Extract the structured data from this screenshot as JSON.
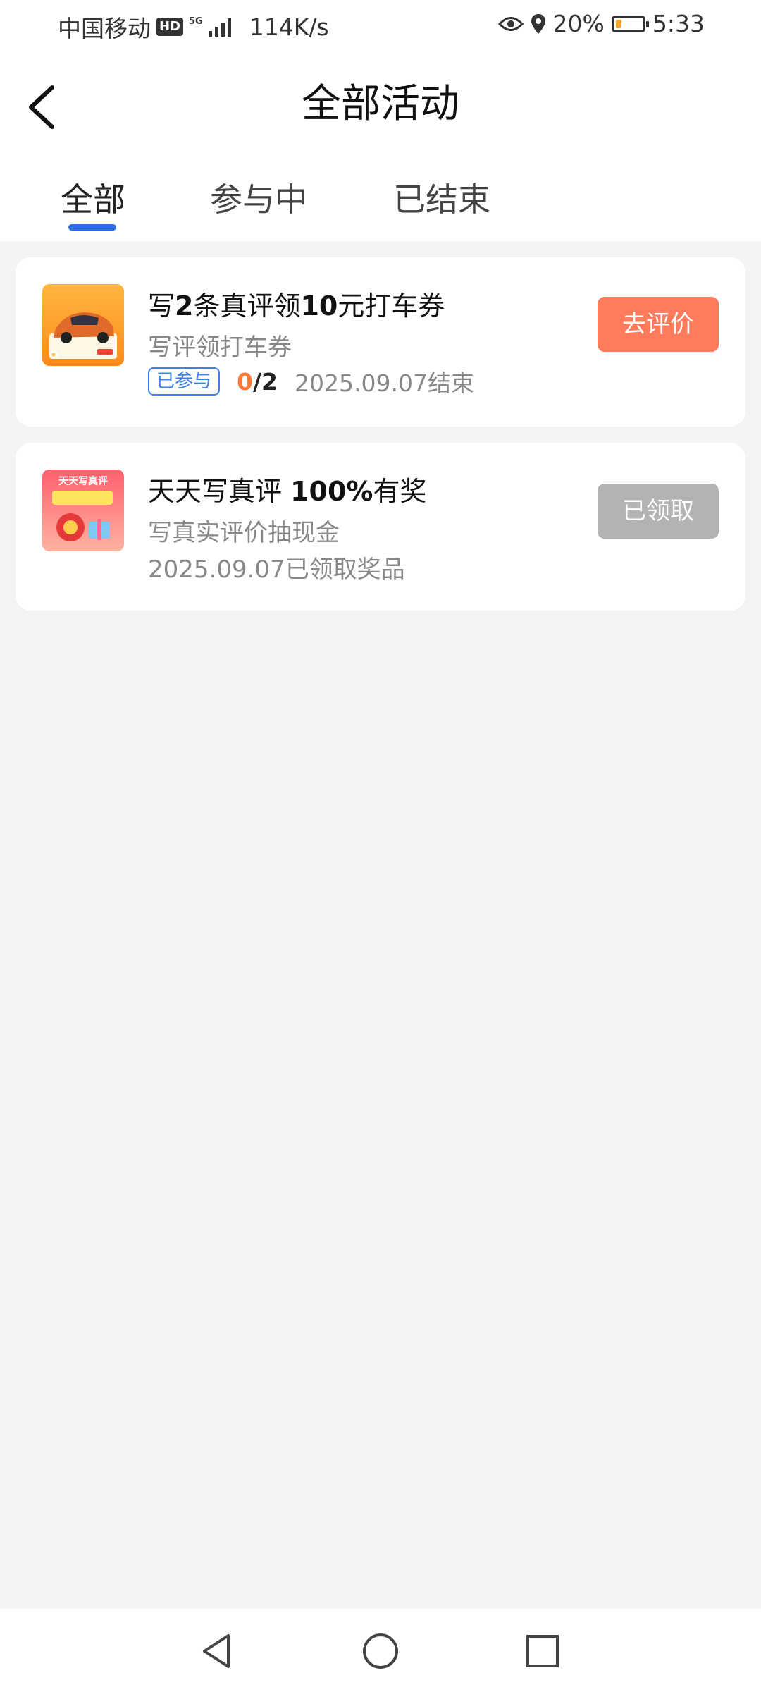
{
  "status_bar": {
    "carrier": "中国移动",
    "hd_badge": "HD",
    "network": "5G",
    "speed": "114K/s",
    "battery": "20%",
    "time": "5:33"
  },
  "header": {
    "title": "全部活动",
    "back_icon": "chevron-left-icon"
  },
  "tabs": [
    {
      "label": "全部",
      "active": true
    },
    {
      "label": "参与中",
      "active": false
    },
    {
      "label": "已结束",
      "active": false
    }
  ],
  "activities": [
    {
      "title_parts": [
        "写",
        "2",
        "条真评领",
        "10",
        "元打车券"
      ],
      "subtitle": "写评领打车券",
      "tag": "已参与",
      "progress_current": "0",
      "progress_total": "/2",
      "end_text": "2025.09.07结束",
      "button": "去评价",
      "button_color": "#ff7b5c"
    },
    {
      "title_parts": [
        "天天写真评 ",
        "100%",
        "有奖"
      ],
      "subtitle": "写真实评价抽现金",
      "meta": "2025.09.07已领取奖品",
      "button": "已领取",
      "button_color": "#b3b3b3",
      "thumb_text": "天天写真评"
    }
  ],
  "nav": [
    "back-triangle-icon",
    "home-circle-icon",
    "recents-square-icon"
  ]
}
